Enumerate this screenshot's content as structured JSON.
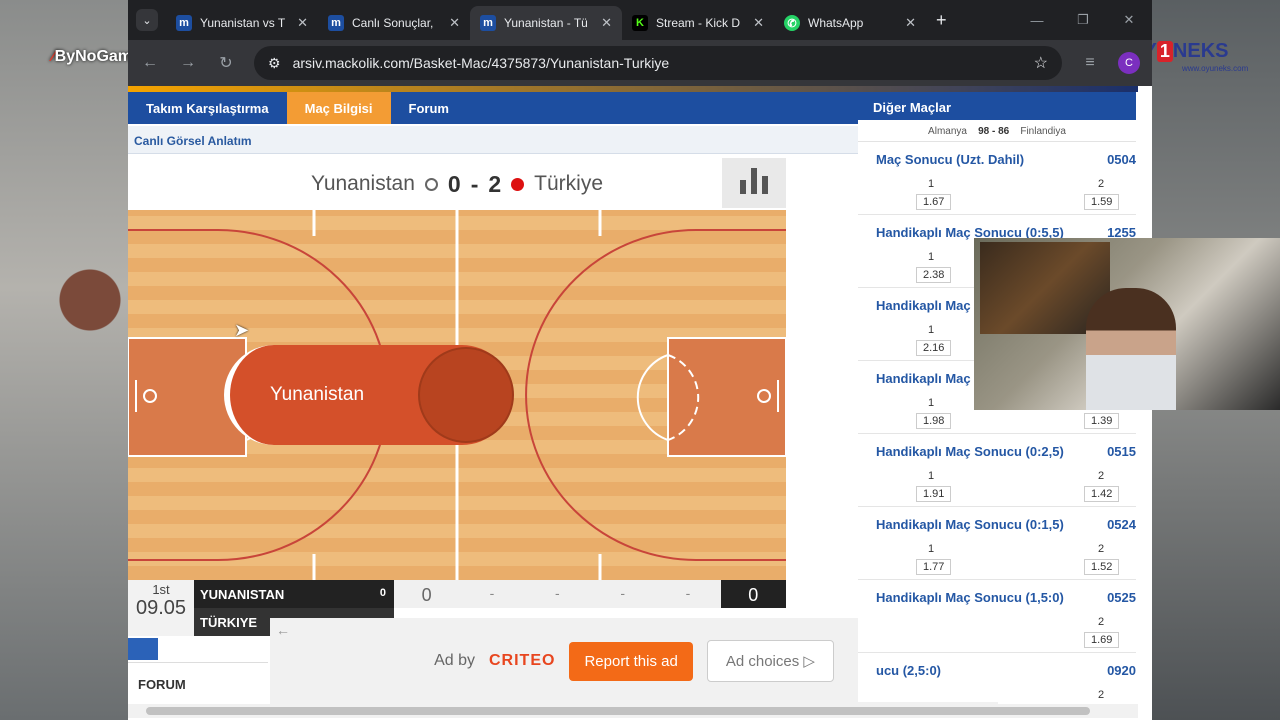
{
  "overlay": {
    "brand_left": "ByNoGame",
    "brand_right_text": "OY NEKS",
    "brand_right_num": "1",
    "brand_right_sub": "www.oyuneks.com"
  },
  "browser": {
    "tabs": [
      {
        "title": "Yunanistan vs T",
        "icon": "m",
        "color": "#1d4ea0"
      },
      {
        "title": "Canlı Sonuçlar,",
        "icon": "m",
        "color": "#1d4ea0"
      },
      {
        "title": "Yunanistan - Tü",
        "icon": "m",
        "color": "#1d4ea0"
      },
      {
        "title": "Stream - Kick D",
        "icon": "K",
        "color": "#53fc18"
      },
      {
        "title": "WhatsApp",
        "icon": "W",
        "color": "#25d366"
      }
    ],
    "new_tab": "+",
    "url": "arsiv.mackolik.com/Basket-Mac/4375873/Yunanistan-Turkiye",
    "profile": "C"
  },
  "page": {
    "nav": [
      "Takım Karşılaştırma",
      "Maç Bilgisi",
      "Forum"
    ],
    "subtitle": "Canlı Görsel Anlatım",
    "score": {
      "home_team": "Yunanistan",
      "home_score": "0",
      "sep": "-",
      "away_score": "2",
      "away_team": "Türkiye"
    },
    "possession_team": "Yunanistan",
    "box": {
      "quarter": "1st",
      "time": "09.05",
      "home_name": "YUNANISTAN",
      "home_pts": "0",
      "away_name": "TÜRKIYE",
      "q1": "0",
      "q2": "-",
      "q3": "-",
      "q4": "-",
      "q5": "-",
      "total": "0"
    },
    "forum_label": "FORUM",
    "ad": {
      "by": "Ad by",
      "brand": "CRITEO",
      "report": "Report this ad",
      "choices": "Ad choices ▷",
      "back": "←"
    }
  },
  "sidebar": {
    "title": "Diğer Maçlar",
    "match": {
      "home": "Almanya",
      "score": "98 - 86",
      "away": "Finlandiya"
    },
    "markets": [
      {
        "title": "Maç Sonucu (Uzt. Dahil)",
        "code": "0504",
        "l1": "1",
        "l2": "2",
        "o1": "1.67",
        "o2": "1.59"
      },
      {
        "title": "Handikaplı Maç Sonucu (0:5,5)",
        "code": "1255",
        "l1": "1",
        "l2": "",
        "o1": "2.38",
        "o2": ""
      },
      {
        "title": "Handikaplı Maç",
        "code": "",
        "l1": "1",
        "l2": "",
        "o1": "2.16",
        "o2": ""
      },
      {
        "title": "Handikaplı Maç",
        "code": "",
        "l1": "1",
        "l2": "",
        "o1": "1.98",
        "o2": "1.39"
      },
      {
        "title": "Handikaplı Maç Sonucu (0:2,5)",
        "code": "0515",
        "l1": "1",
        "l2": "2",
        "o1": "1.91",
        "o2": "1.42"
      },
      {
        "title": "Handikaplı Maç Sonucu (0:1,5)",
        "code": "0524",
        "l1": "1",
        "l2": "2",
        "o1": "1.77",
        "o2": "1.52"
      },
      {
        "title": "Handikaplı Maç Sonucu (1,5:0)",
        "code": "0525",
        "l1": "",
        "l2": "2",
        "o1": "",
        "o2": "1.69"
      },
      {
        "title": "ucu (2,5:0)",
        "code": "0920",
        "l1": "",
        "l2": "2",
        "o1": "",
        "o2": ""
      }
    ]
  }
}
